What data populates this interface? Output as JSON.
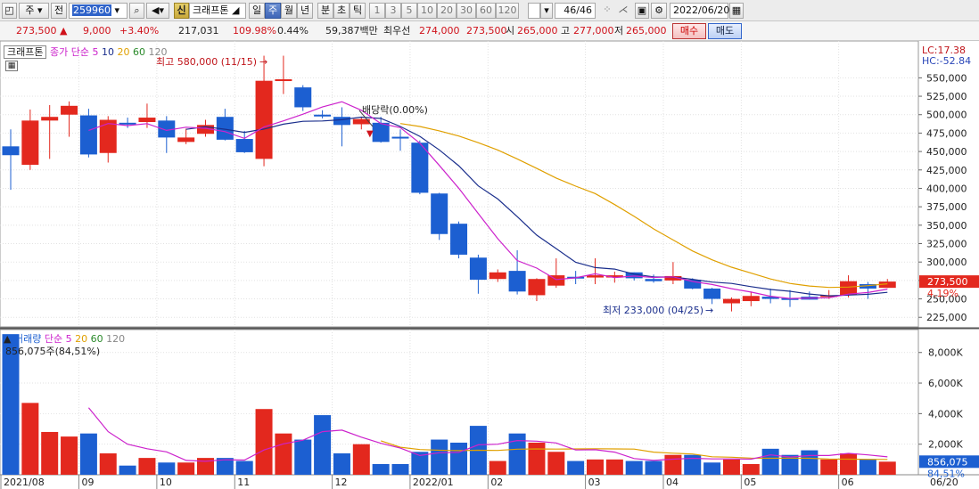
{
  "toolbar": {
    "period_main": "주",
    "jeon": "전",
    "stock_code": "259960",
    "new_badge": "신",
    "stock_name": "크래프톤",
    "period_tabs": [
      "일",
      "주",
      "월",
      "년",
      "분",
      "초",
      "틱"
    ],
    "active_period": "주",
    "interval_tabs": [
      "1",
      "3",
      "5",
      "10",
      "20",
      "30",
      "60",
      "120"
    ],
    "page_counter": "46/46",
    "date": "2022/06/20"
  },
  "info": {
    "price": "273,500",
    "change": "9,000",
    "change_pct": "+3.40%",
    "volume": "217,031",
    "volume_ratio": "109.98%",
    "turnover": "0.44%",
    "amount": "59,387백만",
    "best_label": "최우선",
    "best_ask": "274,000",
    "best_bid": "273,500",
    "open_label": "시",
    "open": "265,000",
    "high_label": "고",
    "high": "277,000",
    "low_label": "저",
    "low": "265,000",
    "buy_label": "매수",
    "sell_label": "매도",
    "up_color": "#d0121b"
  },
  "chart_data": [
    {
      "type": "candlestick",
      "title": "크래프톤",
      "legend": [
        {
          "text": "종가 단순",
          "color": "#cc22cc"
        },
        {
          "text": "5",
          "color": "#cc22cc"
        },
        {
          "text": "10",
          "color": "#1a2e8c"
        },
        {
          "text": "20",
          "color": "#e0a000"
        },
        {
          "text": "60",
          "color": "#2a8a2a"
        },
        {
          "text": "120",
          "color": "#888888"
        }
      ],
      "up_color": "#e3281e",
      "down_color": "#1c5fd1",
      "ylim": [
        212000,
        600000
      ],
      "y_ticks": [
        225000,
        250000,
        275000,
        300000,
        325000,
        350000,
        375000,
        400000,
        425000,
        450000,
        475000,
        500000,
        525000,
        550000
      ],
      "y_tick_labels": [
        "225,000",
        "250,000",
        "275,000",
        "300,000",
        "325,000",
        "350,000",
        "375,000",
        "400,000",
        "425,000",
        "450,000",
        "475,000",
        "500,000",
        "525,000",
        "550,000"
      ],
      "x_labels": [
        "2021/08",
        "09",
        "10",
        "11",
        "12",
        "2022/01",
        "02",
        "03",
        "04",
        "05",
        "06",
        "06/20"
      ],
      "x_label_index": [
        0,
        4,
        8,
        12,
        17,
        21,
        25,
        30,
        34,
        38,
        43
      ],
      "candles": [
        {
          "o": 457000,
          "h": 480000,
          "l": 398000,
          "c": 445000
        },
        {
          "o": 432000,
          "h": 507000,
          "l": 425000,
          "c": 492000
        },
        {
          "o": 492000,
          "h": 513000,
          "l": 440000,
          "c": 497000
        },
        {
          "o": 500000,
          "h": 518000,
          "l": 470000,
          "c": 512000
        },
        {
          "o": 499000,
          "h": 508000,
          "l": 442000,
          "c": 446000
        },
        {
          "o": 448000,
          "h": 498000,
          "l": 435000,
          "c": 493000
        },
        {
          "o": 489000,
          "h": 496000,
          "l": 482000,
          "c": 488000
        },
        {
          "o": 490000,
          "h": 515000,
          "l": 482000,
          "c": 496000
        },
        {
          "o": 492000,
          "h": 498000,
          "l": 448000,
          "c": 469000
        },
        {
          "o": 463000,
          "h": 481000,
          "l": 460000,
          "c": 469000
        },
        {
          "o": 474000,
          "h": 493000,
          "l": 470000,
          "c": 486000
        },
        {
          "o": 497000,
          "h": 508000,
          "l": 465000,
          "c": 466000
        },
        {
          "o": 467000,
          "h": 478000,
          "l": 448000,
          "c": 449000
        },
        {
          "o": 440000,
          "h": 580000,
          "l": 430000,
          "c": 546000
        },
        {
          "o": 548000,
          "h": 580000,
          "l": 528000,
          "c": 548000
        },
        {
          "o": 537000,
          "h": 540000,
          "l": 505000,
          "c": 510000
        },
        {
          "o": 500000,
          "h": 506000,
          "l": 495000,
          "c": 498000
        },
        {
          "o": 497000,
          "h": 510000,
          "l": 457000,
          "c": 486000
        },
        {
          "o": 487000,
          "h": 497000,
          "l": 480000,
          "c": 494000
        },
        {
          "o": 489000,
          "h": 497000,
          "l": 462000,
          "c": 463000
        },
        {
          "o": 470000,
          "h": 480000,
          "l": 451000,
          "c": 469000
        },
        {
          "o": 462000,
          "h": 465000,
          "l": 392000,
          "c": 394000
        },
        {
          "o": 393000,
          "h": 394000,
          "l": 330000,
          "c": 338000
        },
        {
          "o": 352000,
          "h": 355000,
          "l": 305000,
          "c": 310000
        },
        {
          "o": 306000,
          "h": 310000,
          "l": 257000,
          "c": 276000
        },
        {
          "o": 277000,
          "h": 290000,
          "l": 273000,
          "c": 286000
        },
        {
          "o": 288000,
          "h": 316000,
          "l": 256000,
          "c": 260000
        },
        {
          "o": 255000,
          "h": 278000,
          "l": 247000,
          "c": 277000
        },
        {
          "o": 268000,
          "h": 305000,
          "l": 265000,
          "c": 282000
        },
        {
          "o": 280000,
          "h": 288000,
          "l": 270000,
          "c": 279000
        },
        {
          "o": 279000,
          "h": 305000,
          "l": 270000,
          "c": 282000
        },
        {
          "o": 279000,
          "h": 287000,
          "l": 272000,
          "c": 282000
        },
        {
          "o": 286000,
          "h": 286000,
          "l": 275000,
          "c": 278000
        },
        {
          "o": 277000,
          "h": 283000,
          "l": 272000,
          "c": 274000
        },
        {
          "o": 275000,
          "h": 300000,
          "l": 270000,
          "c": 281000
        },
        {
          "o": 276000,
          "h": 278000,
          "l": 263000,
          "c": 264000
        },
        {
          "o": 264000,
          "h": 265000,
          "l": 243000,
          "c": 250000
        },
        {
          "o": 244000,
          "h": 252000,
          "l": 233000,
          "c": 250000
        },
        {
          "o": 247000,
          "h": 260000,
          "l": 240000,
          "c": 254000
        },
        {
          "o": 253000,
          "h": 264000,
          "l": 244000,
          "c": 250000
        },
        {
          "o": 251000,
          "h": 262000,
          "l": 239000,
          "c": 250000
        },
        {
          "o": 253000,
          "h": 260000,
          "l": 249000,
          "c": 249000
        },
        {
          "o": 253000,
          "h": 262000,
          "l": 250000,
          "c": 255000
        },
        {
          "o": 255000,
          "h": 282000,
          "l": 252000,
          "c": 274000
        },
        {
          "o": 270000,
          "h": 273000,
          "l": 250000,
          "c": 264000
        },
        {
          "o": 265000,
          "h": 277000,
          "l": 265000,
          "c": 273500
        }
      ],
      "ma5": [
        null,
        null,
        null,
        null,
        478600,
        488000,
        485200,
        487800,
        478600,
        483000,
        481600,
        477000,
        467800,
        483200,
        491600,
        500600,
        510400,
        517600,
        506000,
        488000,
        482400,
        461200,
        431200,
        400200,
        365800,
        331700,
        302000,
        291800,
        276200,
        278600,
        284100,
        279000,
        281000,
        279100,
        279900,
        273600,
        269500,
        263900,
        259300,
        253600,
        250600,
        251200,
        251500,
        256500,
        258600,
        263200
      ],
      "ma10": [
        null,
        null,
        null,
        null,
        null,
        null,
        null,
        null,
        null,
        480100,
        483600,
        480200,
        476000,
        480500,
        487100,
        491000,
        491400,
        493100,
        496700,
        494900,
        484000,
        470500,
        452200,
        430600,
        403400,
        385600,
        361700,
        336500,
        318200,
        299600,
        292500,
        290500,
        283500,
        279900,
        279600,
        276600,
        272800,
        271000,
        266600,
        262800,
        260400,
        256600,
        254200,
        255200,
        256200,
        258900
      ],
      "ma20": [
        null,
        null,
        null,
        null,
        null,
        null,
        null,
        null,
        null,
        null,
        null,
        null,
        null,
        null,
        null,
        null,
        null,
        null,
        null,
        null,
        488000,
        484000,
        478000,
        471000,
        462000,
        452000,
        440000,
        427000,
        414000,
        403000,
        393000,
        378000,
        362000,
        345000,
        330000,
        315000,
        303000,
        293000,
        285000,
        277000,
        271000,
        267500,
        265500,
        266000,
        268000,
        270500
      ],
      "annotations": {
        "high_label": "최고 580,000 (11/15)",
        "low_label": "최저 233,000 (04/25)",
        "dividend_label": "배당락(0.00%)",
        "lc_label": "LC:17.38",
        "hc_label": "HC:-52.84",
        "last_price_label": "273,500",
        "last_pct_label": "4.19%"
      }
    },
    {
      "type": "bar",
      "title": "거래량",
      "legend": [
        {
          "text": "거래량",
          "color": "#1c5fd1"
        },
        {
          "text": "단순 5",
          "color": "#cc22cc"
        },
        {
          "text": "20",
          "color": "#e0a000"
        },
        {
          "text": "60",
          "color": "#2a8a2a"
        },
        {
          "text": "120",
          "color": "#888888"
        }
      ],
      "info_label": "856,075주(84,51%)",
      "ylim": [
        0,
        9500
      ],
      "y_ticks": [
        2000,
        4000,
        6000,
        8000
      ],
      "y_tick_labels": [
        "2,000K",
        "4,000K",
        "6,000K",
        "8,000K"
      ],
      "last_volume_label": "856,075",
      "last_pct_label": "84,51%",
      "values": [
        9200,
        4700,
        2800,
        2500,
        2700,
        1400,
        600,
        1100,
        800,
        800,
        1100,
        1100,
        900,
        4300,
        2700,
        2300,
        3900,
        1400,
        2000,
        700,
        700,
        1500,
        2300,
        2100,
        3200,
        900,
        2700,
        2100,
        1500,
        900,
        1000,
        1000,
        900,
        900,
        1300,
        1300,
        800,
        1000,
        700,
        1700,
        1300,
        1600,
        1000,
        1400,
        1000,
        856
      ],
      "ma5": [
        null,
        null,
        null,
        null,
        4380,
        2820,
        2000,
        1700,
        1500,
        940,
        880,
        980,
        960,
        1620,
        2020,
        2260,
        2820,
        2920,
        2460,
        2060,
        1740,
        1260,
        1440,
        1460,
        1960,
        2000,
        2240,
        2200,
        2080,
        1620,
        1640,
        1480,
        1060,
        940,
        1020,
        1080,
        1040,
        1040,
        1020,
        1300,
        1160,
        1260,
        1260,
        1400,
        1300,
        1170
      ],
      "ma20": [
        null,
        null,
        null,
        null,
        null,
        null,
        null,
        null,
        null,
        null,
        null,
        null,
        null,
        null,
        null,
        null,
        null,
        null,
        null,
        2220,
        1800,
        1650,
        1600,
        1580,
        1600,
        1590,
        1670,
        1690,
        1680,
        1690,
        1700,
        1690,
        1680,
        1480,
        1410,
        1360,
        1180,
        1150,
        1090,
        1080,
        1090,
        1080,
        1030,
        1020,
        1010,
        1000
      ]
    }
  ]
}
